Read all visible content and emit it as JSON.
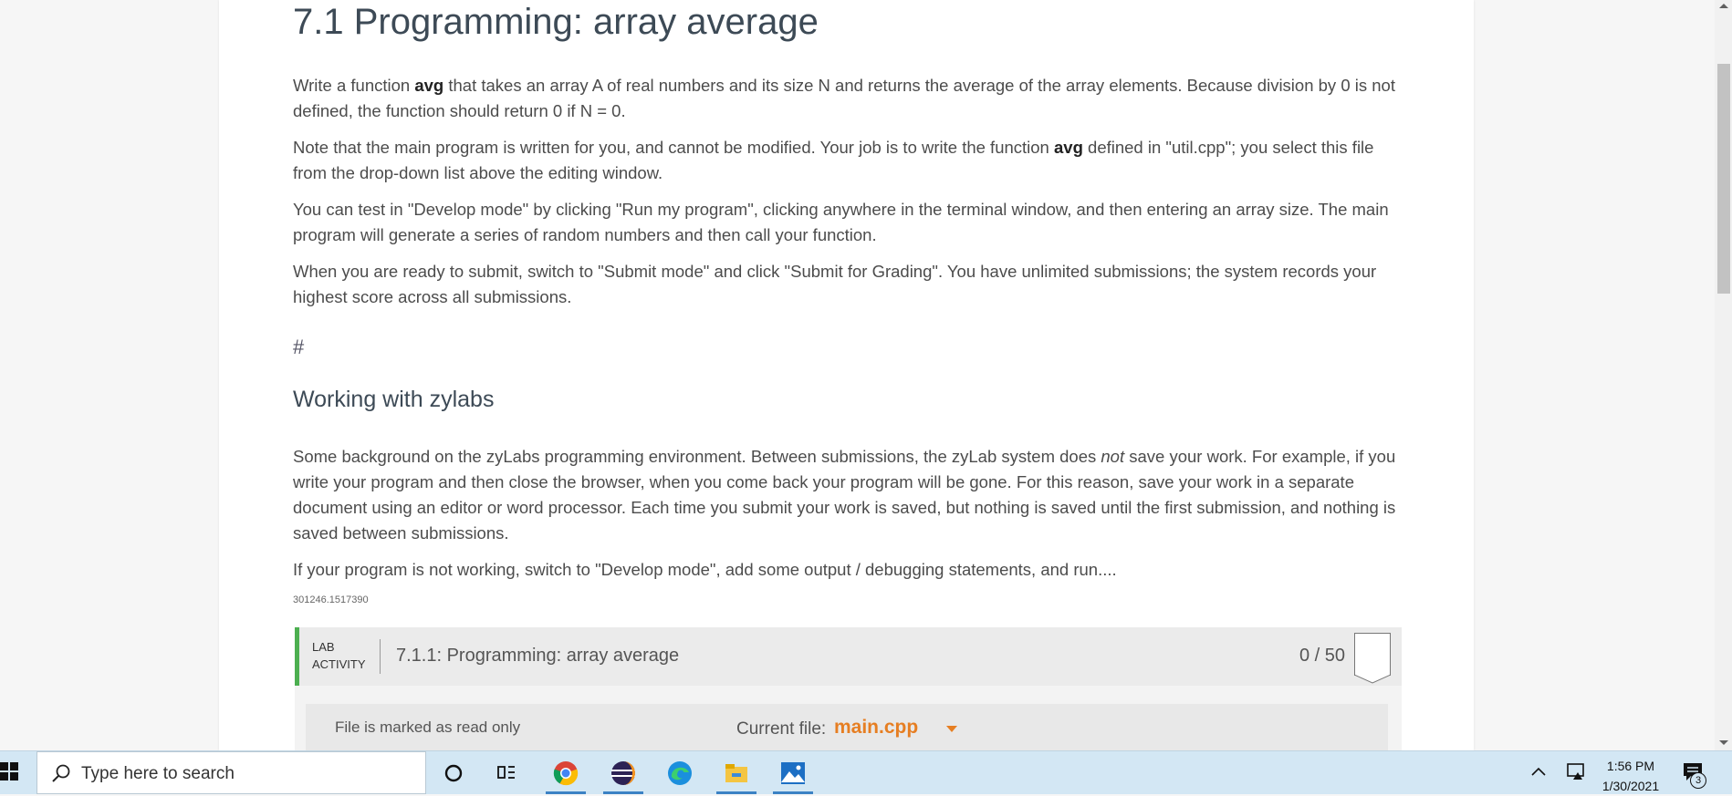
{
  "page": {
    "title": "7.1 Programming: array average",
    "paragraphs": {
      "p1_a": "Write a function ",
      "p1_b": "avg",
      "p1_c": " that takes an array A of real numbers and its size N and returns the average of the array elements. Because division by 0 is not defined, the function should return 0 if N = 0.",
      "p2_a": "Note that the main program is written for you, and cannot be modified. Your job is to write the function ",
      "p2_b": "avg",
      "p2_c": " defined in \"util.cpp\"; you select this file from the drop-down list above the editing window.",
      "p3": "You can test in \"Develop mode\" by clicking \"Run my program\", clicking anywhere in the terminal window, and then entering an array size. The main program will generate a series of random numbers and then call your function.",
      "p4": "When you are ready to submit, switch to \"Submit mode\" and click \"Submit for Grading\". You have unlimited submissions; the system records your highest score across all submissions.",
      "p5_a": "Some background on the zyLabs programming environment. Between submissions, the zyLab system does ",
      "p5_b": "not",
      "p5_c": " save your work. For example, if you write your program and then close the browser, when you come back your program will be gone. For this reason, save your work in a separate document using an editor or word processor. Each time you submit your work is saved, but nothing is saved until the first submission, and nothing is saved between submissions.",
      "p6": "If your program is not working, switch to \"Develop mode\", add some output / debugging statements, and run...."
    },
    "hash": "#",
    "section_heading": "Working with zylabs",
    "content_id": "301246.1517390"
  },
  "lab": {
    "tag_line1": "LAB",
    "tag_line2": "ACTIVITY",
    "title": "7.1.1: Programming: array average",
    "score": "0 / 50",
    "readonly_note": "File is marked as read only",
    "current_file_label": "Current file:",
    "current_file": "main.cpp"
  },
  "taskbar": {
    "search_placeholder": "Type here to search",
    "apps": [
      "cortana-icon",
      "task-view-icon",
      "chrome-icon",
      "eclipse-icon",
      "edge-icon",
      "file-explorer-icon",
      "photos-icon"
    ],
    "time": "1:56 PM",
    "date": "1/30/2021",
    "notification_count": "3"
  },
  "colors": {
    "accent_green": "#4caf50",
    "file_orange": "#e67e22",
    "taskbar_bg": "#d3e7f4"
  }
}
